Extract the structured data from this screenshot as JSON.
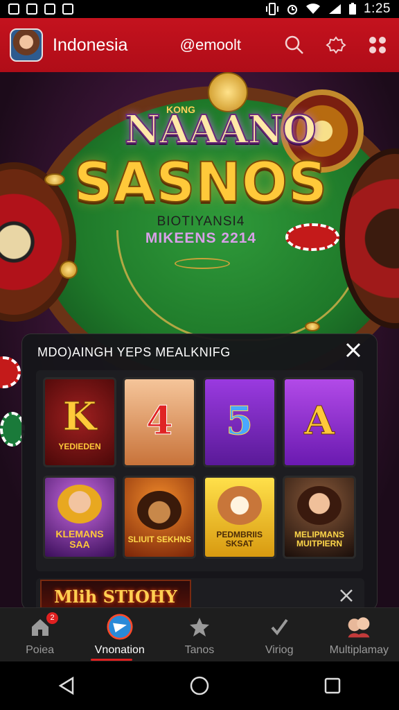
{
  "status_bar": {
    "time": "1:25"
  },
  "header": {
    "title": "Indonesia",
    "handle": "@emoolt"
  },
  "hero": {
    "logo_small": "KONG",
    "logo_top": "NAAANO",
    "logo_main": "SASNOS",
    "subtitle_1": "BIOTIYANSI4",
    "subtitle_2": "MIKEENS 2214"
  },
  "panel": {
    "title": "MDO)AINGH YEPS MEALKNIFG",
    "tiles": [
      {
        "glyph": "K",
        "label": "YEDIEDEN",
        "bg": "#6b1010"
      },
      {
        "glyph": "4",
        "label": "",
        "bg": "#c8733a"
      },
      {
        "glyph": "5",
        "label": "",
        "bg": "#7a2ab8"
      },
      {
        "glyph": "A",
        "label": "",
        "bg": "#8a2ac8"
      },
      {
        "glyph": "",
        "label": "KLEMANS SAA",
        "bg": "#4a1a6a"
      },
      {
        "glyph": "",
        "label": "SLIUIT SEKHNS",
        "bg": "#a0360e"
      },
      {
        "glyph": "",
        "label": "PEDMBRIIS SKSAT",
        "bg": "#e8b818"
      },
      {
        "glyph": "",
        "label": "MELIPMANS MUITPIERN",
        "bg": "#2a1a1a"
      }
    ],
    "promo_text": "Mlih STIOHY"
  },
  "bottom_nav": {
    "items": [
      {
        "label": "Poiea",
        "badge": "2",
        "active": false
      },
      {
        "label": "Vnonation",
        "active": true
      },
      {
        "label": "Tanos",
        "active": false
      },
      {
        "label": "Viriog",
        "active": false
      },
      {
        "label": "Multiplamay",
        "active": false
      }
    ]
  },
  "colors": {
    "header_red": "#c4121e",
    "accent_gold": "#ffc93a",
    "active_indicator": "#e02020"
  }
}
